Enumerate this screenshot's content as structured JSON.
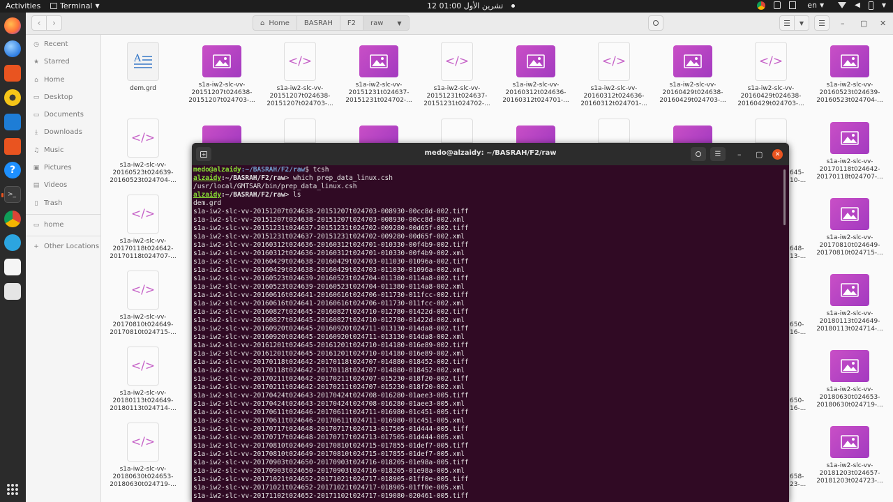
{
  "topbar": {
    "activities": "Activities",
    "app_name": "Terminal",
    "clock": "12 تشرين الأول  01:00",
    "lang": "en"
  },
  "fm": {
    "breadcrumbs": [
      "Home",
      "BASRAH",
      "F2",
      "raw"
    ],
    "sidebar": [
      {
        "label": "Recent",
        "icon": "clock-icon"
      },
      {
        "label": "Starred",
        "icon": "star-icon"
      },
      {
        "label": "Home",
        "icon": "home-icon"
      },
      {
        "label": "Desktop",
        "icon": "folder-icon"
      },
      {
        "label": "Documents",
        "icon": "folder-icon"
      },
      {
        "label": "Downloads",
        "icon": "folder-icon"
      },
      {
        "label": "Music",
        "icon": "music-icon"
      },
      {
        "label": "Pictures",
        "icon": "folder-icon"
      },
      {
        "label": "Videos",
        "icon": "folder-icon"
      },
      {
        "label": "Trash",
        "icon": "trash-icon"
      },
      {
        "label": "home",
        "icon": "folder-icon"
      },
      {
        "label": "Other Locations",
        "icon": "plus-icon"
      }
    ],
    "row1": [
      {
        "type": "doc",
        "l1": "dem.grd",
        "l2": "",
        "l3": ""
      },
      {
        "type": "img",
        "l1": "s1a-iw2-slc-vv-",
        "l2": "20151207t024638-",
        "l3": "20151207t024703-..."
      },
      {
        "type": "code",
        "l1": "s1a-iw2-slc-vv-",
        "l2": "20151207t024638-",
        "l3": "20151207t024703-..."
      },
      {
        "type": "img",
        "l1": "s1a-iw2-slc-vv-",
        "l2": "20151231t024637-",
        "l3": "20151231t024702-..."
      },
      {
        "type": "code",
        "l1": "s1a-iw2-slc-vv-",
        "l2": "20151231t024637-",
        "l3": "20151231t024702-..."
      },
      {
        "type": "img",
        "l1": "s1a-iw2-slc-vv-",
        "l2": "20160312t024636-",
        "l3": "20160312t024701-..."
      },
      {
        "type": "code",
        "l1": "s1a-iw2-slc-vv-",
        "l2": "20160312t024636-",
        "l3": "20160312t024701-..."
      },
      {
        "type": "img",
        "l1": "s1a-iw2-slc-vv-",
        "l2": "20160429t024638-",
        "l3": "20160429t024703-..."
      },
      {
        "type": "code",
        "l1": "s1a-iw2-slc-vv-",
        "l2": "20160429t024638-",
        "l3": "20160429t024703-..."
      },
      {
        "type": "img",
        "l1": "s1a-iw2-slc-vv-",
        "l2": "20160523t024639-",
        "l3": "20160523t024704-..."
      }
    ],
    "left_col": [
      {
        "type": "code",
        "l1": "s1a-iw2-slc-vv-",
        "l2": "20160523t024639-",
        "l3": "20160523t024704-..."
      },
      {
        "type": "code",
        "l1": "s1a-iw2-slc-vv-",
        "l2": "20170118t024642-",
        "l3": "20170118t024707-..."
      },
      {
        "type": "code",
        "l1": "s1a-iw2-slc-vv-",
        "l2": "20170810t024649-",
        "l3": "20170810t024715-..."
      },
      {
        "type": "code",
        "l1": "s1a-iw2-slc-vv-",
        "l2": "20180113t024649-",
        "l3": "20180113t024714-..."
      },
      {
        "type": "code",
        "l1": "s1a-iw2-slc-vv-",
        "l2": "20180630t024653-",
        "l3": "20180630t024719-..."
      }
    ],
    "right_col": [
      {
        "type": "img",
        "l1": "s1a-iw2-slc-vv-",
        "l2": "20170118t024642-",
        "l3": "20170118t024707-..."
      },
      {
        "type": "img",
        "l1": "s1a-iw2-slc-vv-",
        "l2": "20170810t024649-",
        "l3": "20170810t024715-..."
      },
      {
        "type": "img",
        "l1": "s1a-iw2-slc-vv-",
        "l2": "20180113t024649-",
        "l3": "20180113t024714-..."
      },
      {
        "type": "img",
        "l1": "s1a-iw2-slc-vv-",
        "l2": "20180630t024653-",
        "l3": "20180630t024719-..."
      },
      {
        "type": "img",
        "l1": "s1a-iw2-slc-vv-",
        "l2": "20181203t024657-",
        "l3": "20181203t024723-..."
      }
    ],
    "peek": [
      "645-",
      "10-...",
      "648-",
      "13-...",
      "650-",
      "16-...",
      "650-",
      "16-...",
      "658-",
      "23-..."
    ]
  },
  "terminal": {
    "title": "medo@alzaidy: ~/BASRAH/F2/raw",
    "lines": [
      {
        "kind": "prompt1",
        "user": "medo@alzaidy",
        "path": ":~/BASRAH/F2/raw",
        "cmd": "$ tcsh"
      },
      {
        "kind": "prompt2",
        "user": "alzaidy",
        "path": ":~/BASRAH/F2/raw",
        "cmd": "> which prep_data_linux.csh"
      },
      {
        "kind": "out",
        "text": "/usr/local/GMTSAR/bin/prep_data_linux.csh"
      },
      {
        "kind": "prompt2",
        "user": "alzaidy",
        "path": ":~/BASRAH/F2/raw",
        "cmd": "> ls"
      },
      {
        "kind": "out",
        "text": "dem.grd"
      },
      {
        "kind": "out",
        "text": "s1a-iw2-slc-vv-20151207t024638-20151207t024703-008930-00cc8d-002.tiff"
      },
      {
        "kind": "out",
        "text": "s1a-iw2-slc-vv-20151207t024638-20151207t024703-008930-00cc8d-002.xml"
      },
      {
        "kind": "out",
        "text": "s1a-iw2-slc-vv-20151231t024637-20151231t024702-009280-00d65f-002.tiff"
      },
      {
        "kind": "out",
        "text": "s1a-iw2-slc-vv-20151231t024637-20151231t024702-009280-00d65f-002.xml"
      },
      {
        "kind": "out",
        "text": "s1a-iw2-slc-vv-20160312t024636-20160312t024701-010330-00f4b9-002.tiff"
      },
      {
        "kind": "out",
        "text": "s1a-iw2-slc-vv-20160312t024636-20160312t024701-010330-00f4b9-002.xml"
      },
      {
        "kind": "out",
        "text": "s1a-iw2-slc-vv-20160429t024638-20160429t024703-011030-01096a-002.tiff"
      },
      {
        "kind": "out",
        "text": "s1a-iw2-slc-vv-20160429t024638-20160429t024703-011030-01096a-002.xml"
      },
      {
        "kind": "out",
        "text": "s1a-iw2-slc-vv-20160523t024639-20160523t024704-011380-0114a8-002.tiff"
      },
      {
        "kind": "out",
        "text": "s1a-iw2-slc-vv-20160523t024639-20160523t024704-011380-0114a8-002.xml"
      },
      {
        "kind": "out",
        "text": "s1a-iw2-slc-vv-20160616t024641-20160616t024706-011730-011fcc-002.tiff"
      },
      {
        "kind": "out",
        "text": "s1a-iw2-slc-vv-20160616t024641-20160616t024706-011730-011fcc-002.xml"
      },
      {
        "kind": "out",
        "text": "s1a-iw2-slc-vv-20160827t024645-20160827t024710-012780-01422d-002.tiff"
      },
      {
        "kind": "out",
        "text": "s1a-iw2-slc-vv-20160827t024645-20160827t024710-012780-01422d-002.xml"
      },
      {
        "kind": "out",
        "text": "s1a-iw2-slc-vv-20160920t024645-20160920t024711-013130-014da8-002.tiff"
      },
      {
        "kind": "out",
        "text": "s1a-iw2-slc-vv-20160920t024645-20160920t024711-013130-014da8-002.xml"
      },
      {
        "kind": "out",
        "text": "s1a-iw2-slc-vv-20161201t024645-20161201t024710-014180-016e89-002.tiff"
      },
      {
        "kind": "out",
        "text": "s1a-iw2-slc-vv-20161201t024645-20161201t024710-014180-016e89-002.xml"
      },
      {
        "kind": "out",
        "text": "s1a-iw2-slc-vv-20170118t024642-20170118t024707-014880-018452-002.tiff"
      },
      {
        "kind": "out",
        "text": "s1a-iw2-slc-vv-20170118t024642-20170118t024707-014880-018452-002.xml"
      },
      {
        "kind": "out",
        "text": "s1a-iw2-slc-vv-20170211t024642-20170211t024707-015230-018f20-002.tiff"
      },
      {
        "kind": "out",
        "text": "s1a-iw2-slc-vv-20170211t024642-20170211t024707-015230-018f20-002.xml"
      },
      {
        "kind": "out",
        "text": "s1a-iw2-slc-vv-20170424t024643-20170424t024708-016280-01aee3-005.tiff"
      },
      {
        "kind": "out",
        "text": "s1a-iw2-slc-vv-20170424t024643-20170424t024708-016280-01aee3-005.xml"
      },
      {
        "kind": "out",
        "text": "s1a-iw2-slc-vv-20170611t024646-20170611t024711-016980-01c451-005.tiff"
      },
      {
        "kind": "out",
        "text": "s1a-iw2-slc-vv-20170611t024646-20170611t024711-016980-01c451-005.xml"
      },
      {
        "kind": "out",
        "text": "s1a-iw2-slc-vv-20170717t024648-20170717t024713-017505-01d444-005.tiff"
      },
      {
        "kind": "out",
        "text": "s1a-iw2-slc-vv-20170717t024648-20170717t024713-017505-01d444-005.xml"
      },
      {
        "kind": "out",
        "text": "s1a-iw2-slc-vv-20170810t024649-20170810t024715-017855-01def7-005.tiff"
      },
      {
        "kind": "out",
        "text": "s1a-iw2-slc-vv-20170810t024649-20170810t024715-017855-01def7-005.xml"
      },
      {
        "kind": "out",
        "text": "s1a-iw2-slc-vv-20170903t024650-20170903t024716-018205-01e98a-005.tiff"
      },
      {
        "kind": "out",
        "text": "s1a-iw2-slc-vv-20170903t024650-20170903t024716-018205-01e98a-005.xml"
      },
      {
        "kind": "out",
        "text": "s1a-iw2-slc-vv-20171021t024652-20171021t024717-018905-01ff0e-005.tiff"
      },
      {
        "kind": "out",
        "text": "s1a-iw2-slc-vv-20171021t024652-20171021t024717-018905-01ff0e-005.xml"
      },
      {
        "kind": "out",
        "text": "s1a-iw2-slc-vv-20171102t024652-20171102t024717-019080-020461-005.tiff"
      }
    ]
  }
}
